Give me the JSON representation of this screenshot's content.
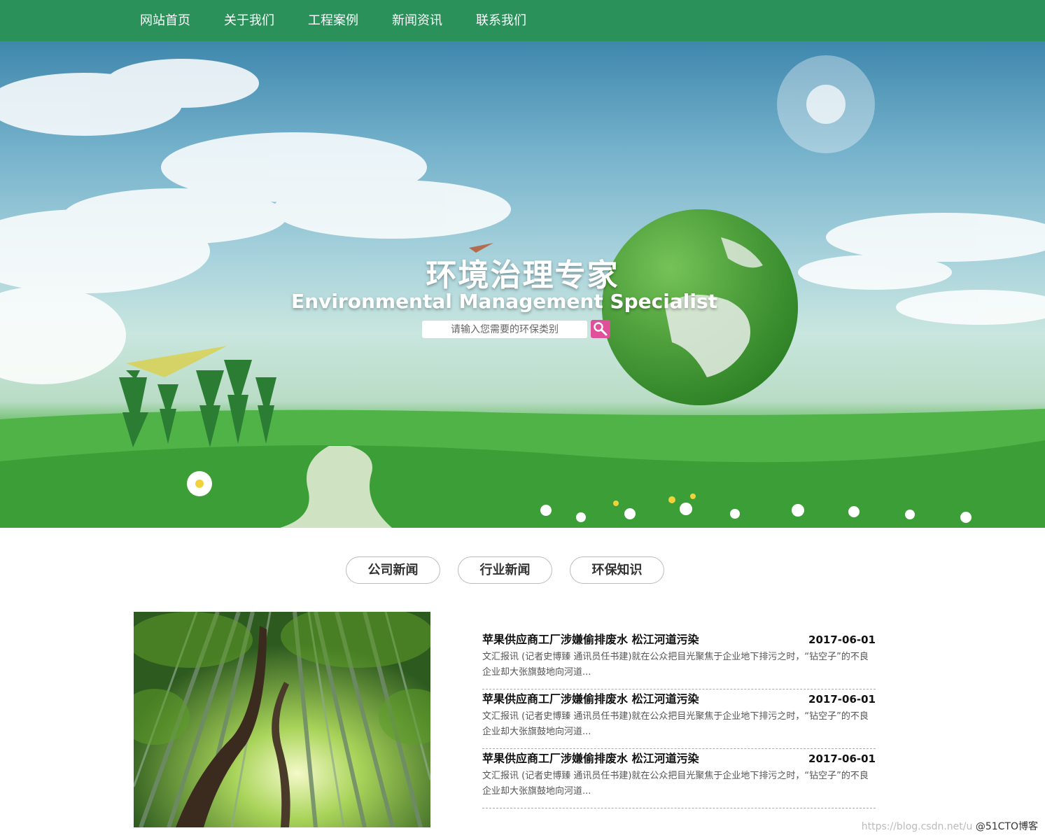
{
  "nav": {
    "items": [
      "网站首页",
      "关于我们",
      "工程案例",
      "新闻资讯",
      "联系我们"
    ]
  },
  "hero": {
    "title": "环境治理专家",
    "subtitle": "Environmental Management Specialist",
    "search_placeholder": "请输入您需要的环保类别"
  },
  "tabs": [
    "公司新闻",
    "行业新闻",
    "环保知识"
  ],
  "news": [
    {
      "title": "苹果供应商工厂涉嫌偷排废水 松江河道污染",
      "date": "2017-06-01",
      "summary": "文汇报讯 (记者史博臻 通讯员任书建)就在公众把目光聚焦于企业地下排污之时，“钻空子”的不良企业却大张旗鼓地向河道..."
    },
    {
      "title": "苹果供应商工厂涉嫌偷排废水 松江河道污染",
      "date": "2017-06-01",
      "summary": "文汇报讯 (记者史博臻 通讯员任书建)就在公众把目光聚焦于企业地下排污之时，“钻空子”的不良企业却大张旗鼓地向河道..."
    },
    {
      "title": "苹果供应商工厂涉嫌偷排废水 松江河道污染",
      "date": "2017-06-01",
      "summary": "文汇报讯 (记者史博臻 通讯员任书建)就在公众把目光聚焦于企业地下排污之时，“钻空子”的不良企业却大张旗鼓地向河道..."
    }
  ],
  "watermark": {
    "url": "https://blog.csdn.net/u",
    "brand": "@51CTO博客"
  },
  "colors": {
    "nav_bg": "#2a915a",
    "search_button": "#e0509a"
  }
}
